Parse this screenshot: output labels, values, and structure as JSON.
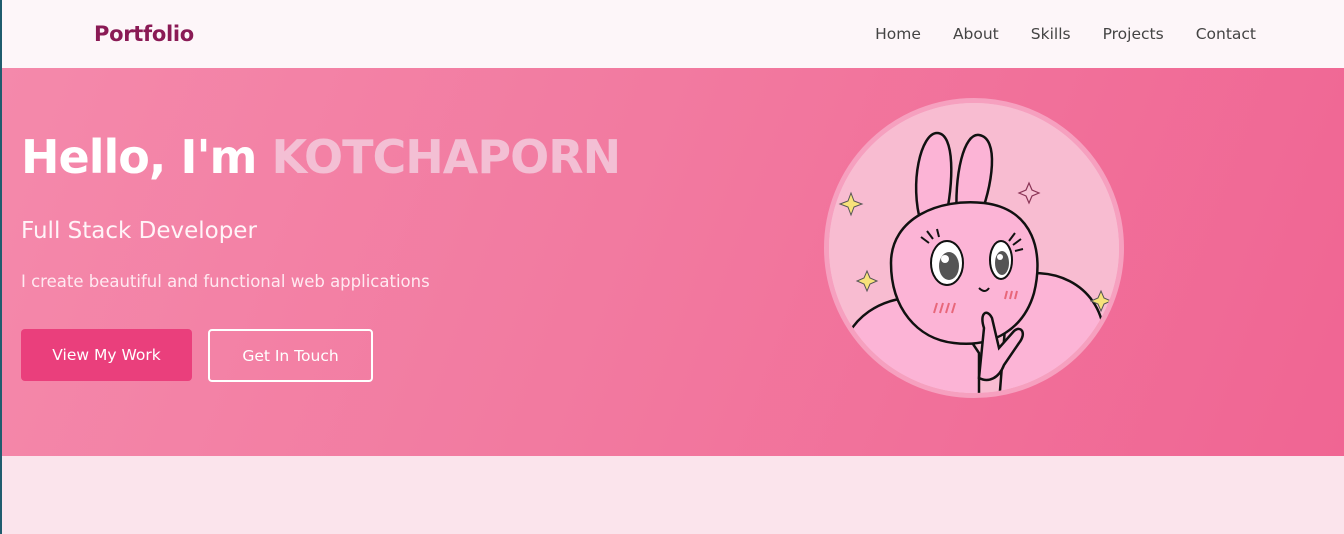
{
  "nav": {
    "brand": "Portfolio",
    "links": [
      "Home",
      "About",
      "Skills",
      "Projects",
      "Contact"
    ]
  },
  "hero": {
    "greeting": "Hello, I'm ",
    "name": "KOTCHAPORN",
    "role": "Full Stack Developer",
    "tagline": "I create beautiful and functional web applications",
    "primary_button": "View My Work",
    "secondary_button": "Get In Touch",
    "avatar_icon": "bunny-character-illustration"
  },
  "colors": {
    "brand": "#8a1a55",
    "hero_gradient_start": "#f489ab",
    "hero_gradient_end": "#f06593",
    "name_accent": "#f3bfd4",
    "primary_button": "#ea3f7c",
    "page_bg": "#fbe4ec"
  }
}
